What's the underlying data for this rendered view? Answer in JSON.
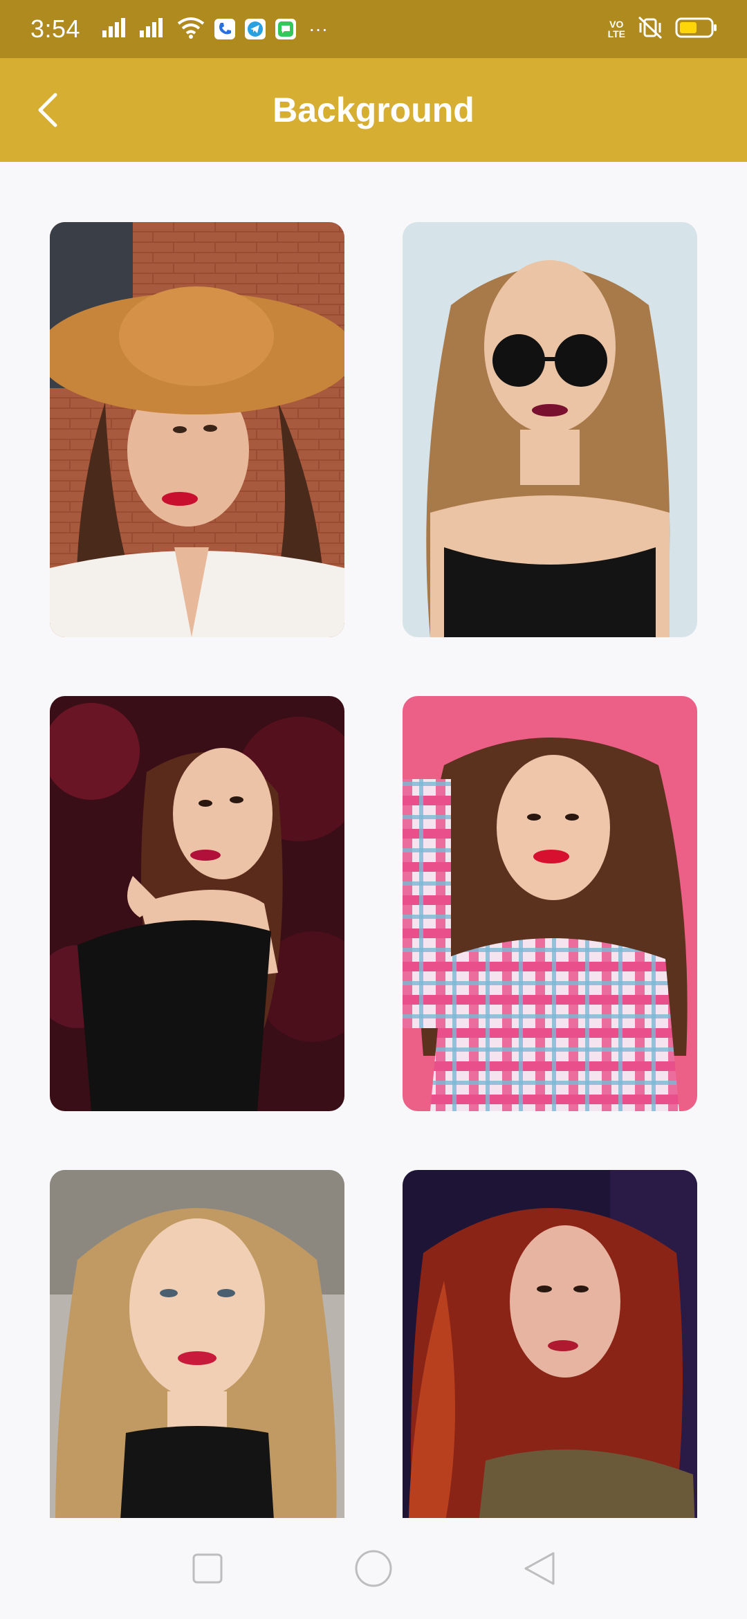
{
  "status_bar": {
    "time": "3:54",
    "volte_top": "VO",
    "volte_bottom": "LTE",
    "background": "#ae8a1f"
  },
  "app_bar": {
    "title": "Background",
    "back_icon": "chevron-left-icon",
    "background": "#d6ae31"
  },
  "backgrounds": [
    {
      "name": "background-1",
      "scene": "straw hat, brick wall, white shirt"
    },
    {
      "name": "background-2",
      "scene": "round sunglasses, light blue wall, black top"
    },
    {
      "name": "background-3",
      "scene": "dark red foliage, black off-shoulder top"
    },
    {
      "name": "background-4",
      "scene": "pink backdrop, plaid shirt"
    },
    {
      "name": "background-5",
      "scene": "long blonde hair, black sweater"
    },
    {
      "name": "background-6",
      "scene": "red hair, dark purple backdrop"
    }
  ],
  "nav_bar": {
    "recents_icon": "square-icon",
    "home_icon": "circle-icon",
    "back_icon": "triangle-back-icon"
  }
}
